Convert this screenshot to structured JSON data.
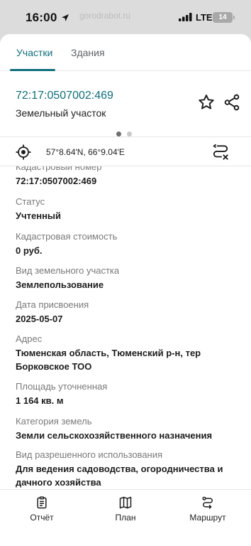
{
  "status_bar": {
    "time": "16:00",
    "network": "LTE",
    "battery": "14",
    "faded_text": "gorodrabot.ru"
  },
  "tabs": [
    {
      "label": "Участки",
      "active": true
    },
    {
      "label": "Здания",
      "active": false
    }
  ],
  "parcel": {
    "cadastral_link": "72:17:0507002:469",
    "type": "Земельный участок",
    "carousel_pages": 2,
    "carousel_active": 0
  },
  "location": {
    "coords": "57°8.64'N, 66°9.04'E"
  },
  "fields": [
    {
      "label": "Кадастровый номер",
      "value": "72:17:0507002:469"
    },
    {
      "label": "Статус",
      "value": "Учтенный"
    },
    {
      "label": "Кадастровая стоимость",
      "value": "0 руб."
    },
    {
      "label": "Вид земельного участка",
      "value": "Землепользование"
    },
    {
      "label": "Дата присвоения",
      "value": "2025-05-07"
    },
    {
      "label": "Адрес",
      "value": "Тюменская область, Тюменский р-н, тер Борковское ТОО"
    },
    {
      "label": "Площадь уточненная",
      "value": "1 164 кв. м"
    },
    {
      "label": "Категория земель",
      "value": "Земли сельскохозяйственного назначения"
    },
    {
      "label": "Вид разрешенного использования",
      "value": "Для ведения садоводства, огородничества и дачного хозяйства"
    }
  ],
  "bottom_nav": [
    {
      "label": "Отчёт",
      "icon": "report-icon"
    },
    {
      "label": "План",
      "icon": "map-icon"
    },
    {
      "label": "Маршрут",
      "icon": "route-icon"
    }
  ],
  "colors": {
    "accent": "#0f6f7c",
    "backdrop": "#dcdcdc"
  }
}
